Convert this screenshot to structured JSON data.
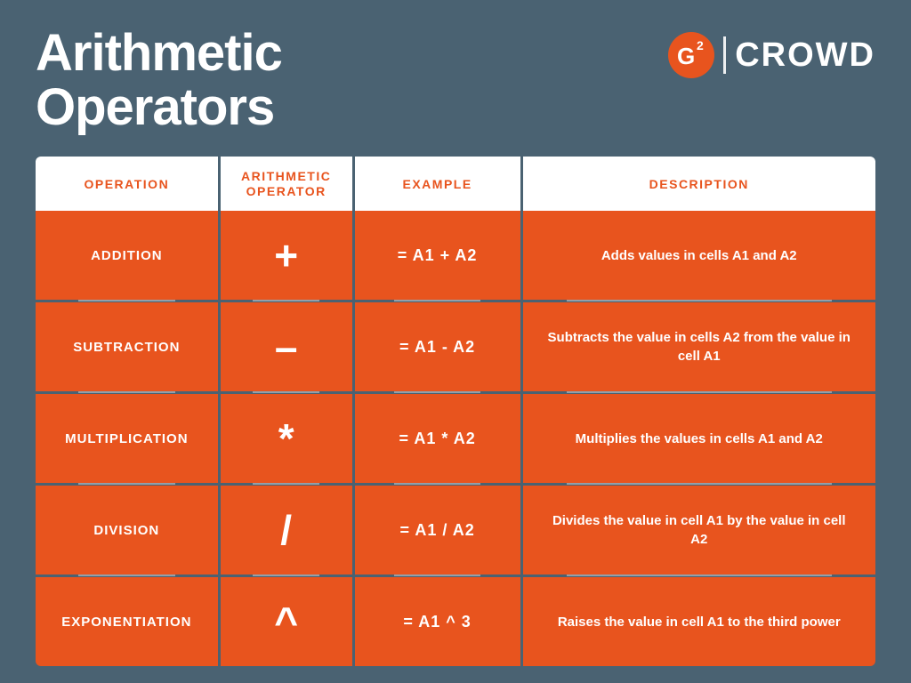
{
  "page": {
    "background_color": "#4a6272",
    "title_line1": "Arithmetic",
    "title_line2": "Operators"
  },
  "logo": {
    "brand": "CROWD",
    "icon_label": "G2"
  },
  "table": {
    "headers": {
      "operation": "OPERATION",
      "operator": "ARITHMETIC OPERATOR",
      "example": "EXAMPLE",
      "description": "DESCRIPTION"
    },
    "rows": [
      {
        "operation": "ADDITION",
        "operator": "+",
        "example": "= A1 + A2",
        "description": "Adds values in cells A1 and A2"
      },
      {
        "operation": "SUBTRACTION",
        "operator": "–",
        "example": "= A1 - A2",
        "description": "Subtracts  the value in cells A2 from the value in cell A1"
      },
      {
        "operation": "MULTIPLICATION",
        "operator": "*",
        "example": "= A1 * A2",
        "description": "Multiplies the values in cells A1 and A2"
      },
      {
        "operation": "DIVISION",
        "operator": "/",
        "example": "= A1 / A2",
        "description": "Divides the value in cell A1 by the value in cell A2"
      },
      {
        "operation": "EXPONENTIATION",
        "operator": "^",
        "example": "= A1 ^ 3",
        "description": "Raises the value in cell A1 to the third power"
      }
    ]
  }
}
